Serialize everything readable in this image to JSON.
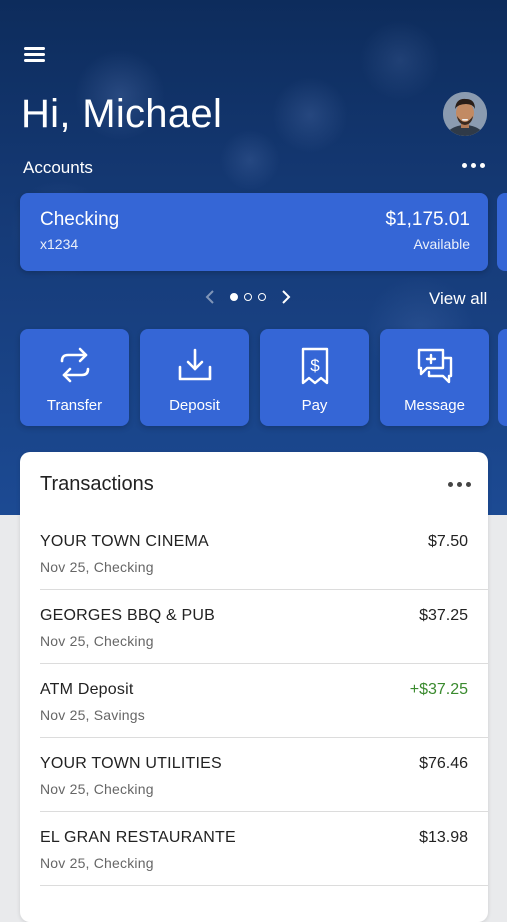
{
  "header": {
    "greeting": "Hi, Michael",
    "accounts_label": "Accounts"
  },
  "accounts": [
    {
      "name": "Checking",
      "number": "x1234",
      "balance": "$1,175.01",
      "balance_label": "Available"
    }
  ],
  "pager": {
    "view_all_label": "View all"
  },
  "actions": [
    {
      "label": "Transfer",
      "icon": "transfer-icon"
    },
    {
      "label": "Deposit",
      "icon": "deposit-icon"
    },
    {
      "label": "Pay",
      "icon": "pay-icon"
    },
    {
      "label": "Message",
      "icon": "message-icon"
    }
  ],
  "transactions": {
    "title": "Transactions",
    "items": [
      {
        "description": "YOUR TOWN CINEMA",
        "meta": "Nov 25, Checking",
        "amount": "$7.50",
        "credit": false
      },
      {
        "description": "GEORGES BBQ & PUB",
        "meta": "Nov 25, Checking",
        "amount": "$37.25",
        "credit": false
      },
      {
        "description": "ATM Deposit",
        "meta": "Nov 25, Savings",
        "amount": "+$37.25",
        "credit": true
      },
      {
        "description": "YOUR TOWN UTILITIES",
        "meta": "Nov 25, Checking",
        "amount": "$76.46",
        "credit": false
      },
      {
        "description": "EL GRAN RESTAURANTE",
        "meta": "Nov 25, Checking",
        "amount": "$13.98",
        "credit": false
      }
    ]
  },
  "colors": {
    "card_blue": "#3566d6",
    "credit_green": "#3a8a2e",
    "hero_dark": "#0d2c5c"
  }
}
